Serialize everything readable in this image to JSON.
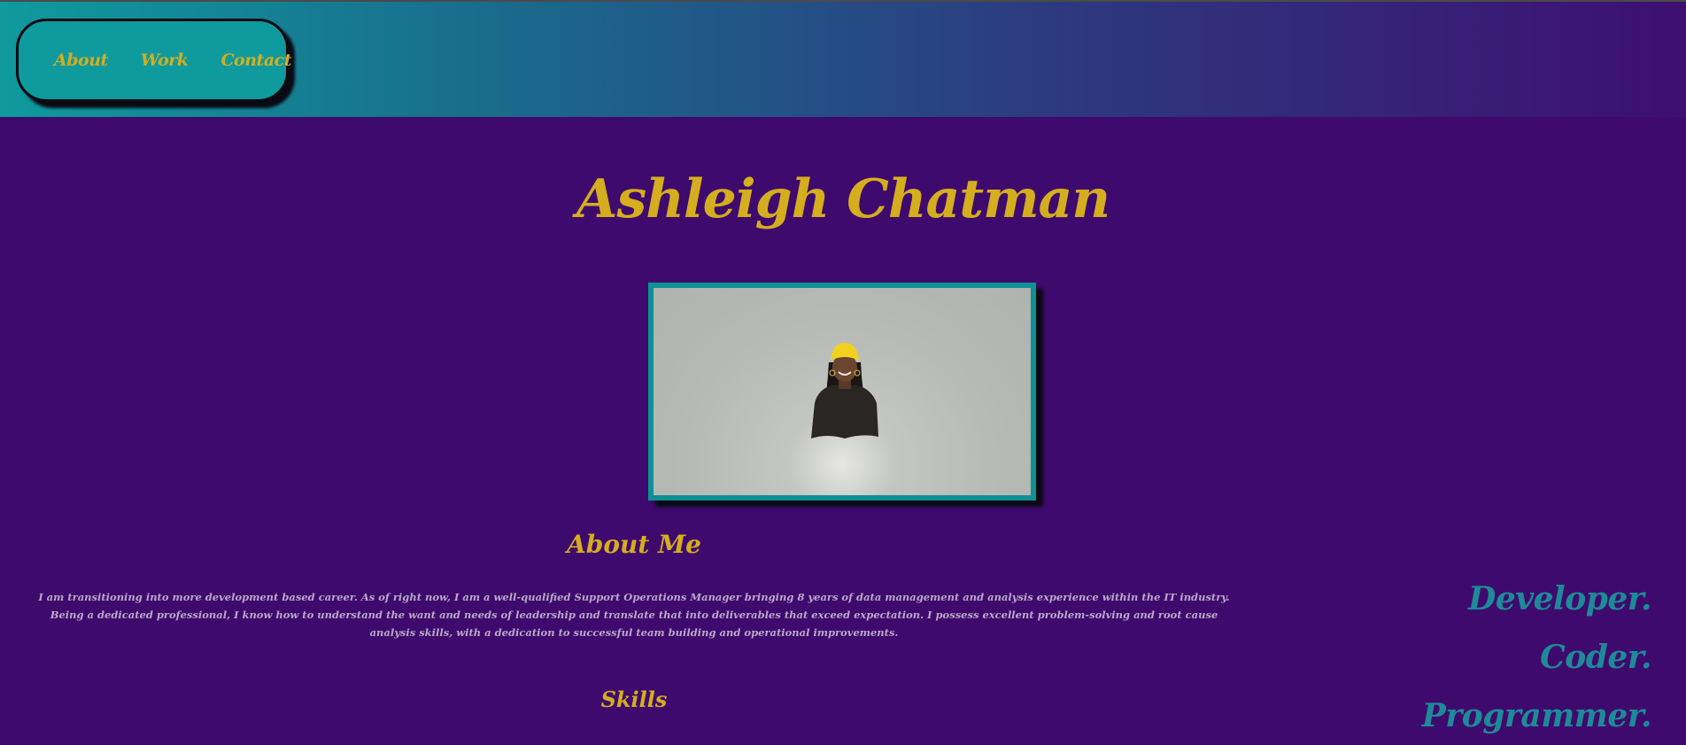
{
  "nav": {
    "items": [
      {
        "label": "About"
      },
      {
        "label": "Work"
      },
      {
        "label": "Contact"
      }
    ]
  },
  "hero": {
    "name": "Ashleigh Chatman"
  },
  "about": {
    "title": "About Me",
    "text": "I am transitioning into more development based career. As of right now, I am a well-qualified Support Operations Manager bringing 8 years of data management and analysis experience within the IT industry. Being a dedicated professional, I know how to understand the want and needs of leadership and translate that into deliverables that exceed expectation. I possess excellent problem-solving and root cause analysis skills, with a dedication to successful team building and operational improvements."
  },
  "skills": {
    "title": "Skills"
  },
  "roles": [
    "Developer.",
    "Coder.",
    "Programmer."
  ],
  "colors": {
    "background": "#3f0a6e",
    "accent_gold": "#d4ae1e",
    "accent_teal": "#0f9a9e",
    "role_teal": "#1e8a98"
  }
}
